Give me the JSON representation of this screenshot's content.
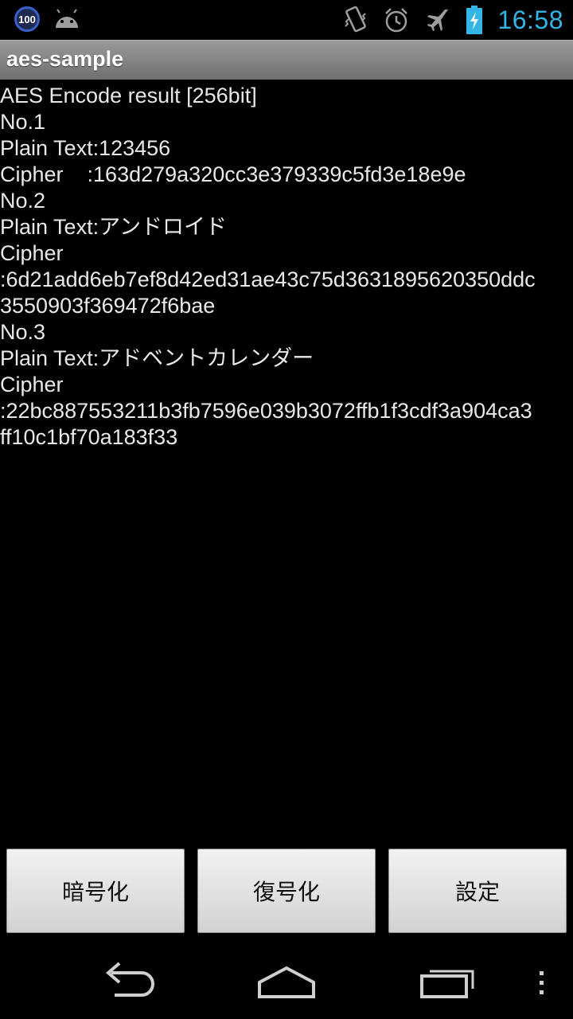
{
  "status_bar": {
    "notification_badge": "100",
    "time": "16:58",
    "icons": [
      "badge-icon",
      "android-icon",
      "vibrate-icon",
      "alarm-icon",
      "airplane-icon",
      "battery-charging-icon"
    ]
  },
  "action_bar": {
    "title": "aes-sample"
  },
  "content": {
    "lines": [
      "AES Encode result [256bit]",
      "No.1",
      "Plain Text:123456",
      "Cipher    :163d279a320cc3e379339c5fd3e18e9e",
      "No.2",
      "Plain Text:アンドロイド",
      "Cipher",
      ":6d21add6eb7ef8d42ed31ae43c75d3631895620350ddc",
      "3550903f369472f6bae",
      "No.3",
      "Plain Text:アドベントカレンダー",
      "Cipher",
      ":22bc887553211b3fb7596e039b3072ffb1f3cdf3a904ca3",
      "ff10c1bf70a183f33"
    ]
  },
  "buttons": {
    "encrypt": "暗号化",
    "decrypt": "復号化",
    "settings": "設定"
  },
  "nav_bar": {
    "icons": [
      "back-icon",
      "home-icon",
      "recent-apps-icon",
      "menu-icon"
    ]
  }
}
